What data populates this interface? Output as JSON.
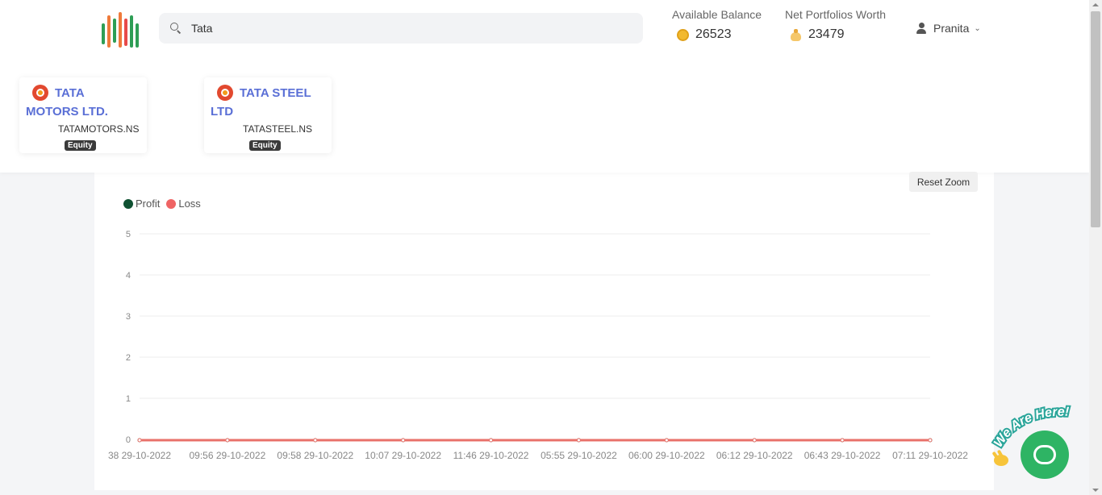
{
  "header": {
    "search": {
      "value": "Tata",
      "placeholder": ""
    },
    "balance": {
      "label": "Available Balance",
      "value": "26523"
    },
    "portfolio": {
      "label": "Net Portfolios Worth",
      "value": "23479"
    },
    "user": {
      "name": "Pranita"
    }
  },
  "results": [
    {
      "name": "TATA MOTORS LTD.",
      "symbol": "TATAMOTORS.NS",
      "badge": "Equity"
    },
    {
      "name": "TATA STEEL LTD",
      "symbol": "TATASTEEL.NS",
      "badge": "Equity"
    }
  ],
  "toolbar": {
    "reset_zoom": "Reset Zoom"
  },
  "legend": [
    {
      "label": "Profit",
      "color": "#0f5132"
    },
    {
      "label": "Loss",
      "color": "#ef6464"
    }
  ],
  "chat": {
    "tag": "We Are Here!"
  },
  "colors": {
    "accent": "#5a6fd6",
    "chat": "#2eb464",
    "loss_line": "#e8716a"
  },
  "chart_data": {
    "type": "line",
    "categories": [
      "38 29-10-2022",
      "09:56 29-10-2022",
      "09:58 29-10-2022",
      "10:07 29-10-2022",
      "11:46 29-10-2022",
      "05:55 29-10-2022",
      "06:00 29-10-2022",
      "06:12 29-10-2022",
      "06:43 29-10-2022",
      "07:11 29-10-2022"
    ],
    "series": [
      {
        "name": "Profit",
        "values": [
          0,
          0,
          0,
          0,
          0,
          0,
          0,
          0,
          0,
          0
        ]
      },
      {
        "name": "Loss",
        "values": [
          0,
          0,
          0,
          0,
          0,
          0,
          0,
          0,
          0,
          0
        ]
      }
    ],
    "y_ticks": [
      0,
      1,
      2,
      3,
      4,
      5
    ],
    "ylim": [
      0,
      5
    ],
    "grid": true,
    "legend_position": "top-left"
  }
}
